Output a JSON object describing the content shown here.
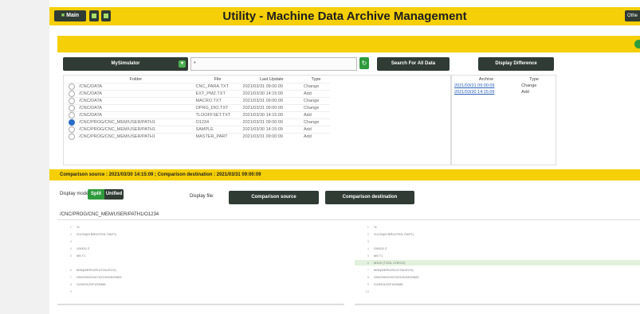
{
  "header": {
    "main_button": "Main",
    "title": "Utility - Machine Data Archive Management",
    "right_button": "Othe"
  },
  "toolbar": {
    "machine_select": "MySimulator",
    "search_value": "*",
    "search_all_button": "Search For All Data",
    "display_difference_button": "Display Difference"
  },
  "file_table": {
    "columns": [
      "Folder",
      "File",
      "Last Update",
      "Type"
    ],
    "rows": [
      {
        "selected": false,
        "folder": "/CNC/DATA",
        "file": "CNC_PARA.TXT",
        "last_update": "2021/03/31 09:00:09",
        "type": "Change"
      },
      {
        "selected": false,
        "folder": "/CNC/DATA",
        "file": "EXT_PMZ.TXT",
        "last_update": "2021/03/30 14:15:09",
        "type": "Add"
      },
      {
        "selected": false,
        "folder": "/CNC/DATA",
        "file": "MACRO.TXT",
        "last_update": "2021/03/31 09:00:09",
        "type": "Change"
      },
      {
        "selected": false,
        "folder": "/CNC/DATA",
        "file": "OPRG_DIO.TXT",
        "last_update": "2021/03/31 09:00:09",
        "type": "Change"
      },
      {
        "selected": false,
        "folder": "/CNC/DATA",
        "file": "TLOOFFSET.TXT",
        "last_update": "2021/03/30 14:15:09",
        "type": "Add"
      },
      {
        "selected": true,
        "folder": "/CNC/PROG/CNC_MEM/USER/PATH1",
        "file": "O1234",
        "last_update": "2021/03/31 09:00:09",
        "type": "Change"
      },
      {
        "selected": false,
        "folder": "/CNC/PROG/CNC_MEM/USER/PATH1",
        "file": "SAMPLE",
        "last_update": "2021/03/30 14:15:09",
        "type": "Add"
      },
      {
        "selected": false,
        "folder": "/CNC/PROG/CNC_MEM/USER/PATH1",
        "file": "MASTER_PART",
        "last_update": "2021/03/31 09:00:09",
        "type": "Add"
      }
    ]
  },
  "archive_table": {
    "columns": [
      "Archive",
      "Type"
    ],
    "rows": [
      {
        "archive": "2021/03/31 09:00:09",
        "type": "Change"
      },
      {
        "archive": "2021/03/30 14:15:09",
        "type": "Add"
      }
    ]
  },
  "comparison_banner": "Comparison source : 2021/03/30 14:15:09 ; Comparison destination : 2021/03/31 09:00:09",
  "display_mode": {
    "label": "Display mode:",
    "split": "Split",
    "unified": "Unified",
    "file_label": "Display file:",
    "source_button": "Comparison source",
    "destination_button": "Comparison destination"
  },
  "path": "/CNC/PROG/CNC_MEM/USER/PATH1/O1234",
  "diff": {
    "left": [
      {
        "n": "1",
        "t": "%",
        "add": false
      },
      {
        "n": "2",
        "t": "O1234(M BRUSTEIL PART)",
        "add": false
      },
      {
        "n": "3",
        "t": "",
        "add": false
      },
      {
        "n": "4",
        "t": "G90G0 Z",
        "add": false
      },
      {
        "n": "5",
        "t": "M6 T1",
        "add": false
      },
      {
        "n": "",
        "t": "",
        "add": false
      },
      {
        "n": "6",
        "t": "M06(WERKZEUGTAUSCH)",
        "add": false
      },
      {
        "n": "7",
        "t": "G54G90G0X0Y0Z100S3000M3",
        "add": false
      },
      {
        "n": "8",
        "t": "G43H01Z5F1000M8",
        "add": false
      },
      {
        "n": "9",
        "t": "",
        "add": false
      }
    ],
    "right": [
      {
        "n": "1",
        "t": "%",
        "add": false
      },
      {
        "n": "2",
        "t": "O1234(M BRUSTEIL PART)",
        "add": false
      },
      {
        "n": "3",
        "t": "",
        "add": false
      },
      {
        "n": "4",
        "t": "G90G0 Z",
        "add": false
      },
      {
        "n": "5",
        "t": "M6 T1",
        "add": false
      },
      {
        "n": "6",
        "t": "M100 (TOOL CHECK)",
        "add": true
      },
      {
        "n": "7",
        "t": "M06(WERKZEUGTAUSCH)",
        "add": false
      },
      {
        "n": "8",
        "t": "G54G90G0X0Y0Z100S3000M3",
        "add": false
      },
      {
        "n": "9",
        "t": "G43H01Z5F1000M8",
        "add": false
      },
      {
        "n": "10",
        "t": "",
        "add": false
      }
    ]
  }
}
